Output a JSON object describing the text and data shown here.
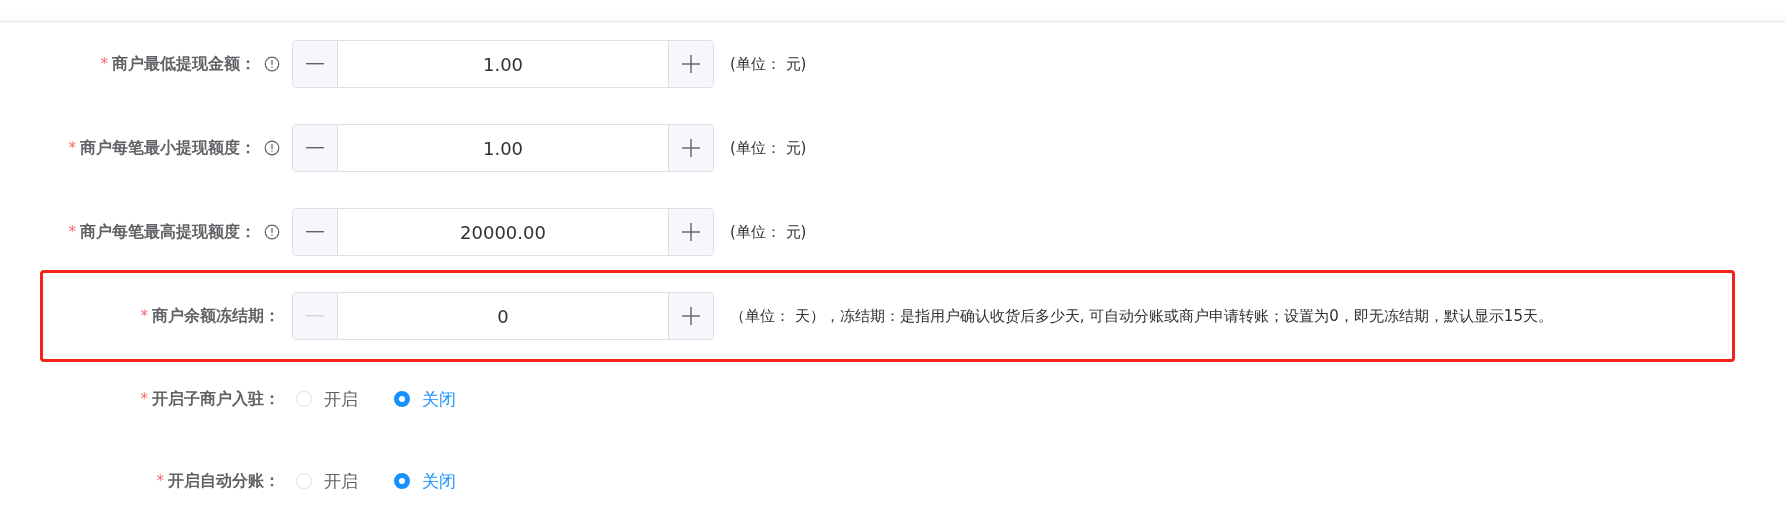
{
  "fields": [
    {
      "kind": "stepper",
      "label": "商户最低提现金额：",
      "required": true,
      "required_mark": "*",
      "info": true,
      "highlighted": false,
      "value": "1.00",
      "minus_disabled": false,
      "hint": "(单位： 元)"
    },
    {
      "kind": "stepper",
      "label": "商户每笔最小提现额度：",
      "required": true,
      "required_mark": "*",
      "info": true,
      "highlighted": false,
      "value": "1.00",
      "minus_disabled": false,
      "hint": "(单位： 元)"
    },
    {
      "kind": "stepper",
      "label": "商户每笔最高提现额度：",
      "required": true,
      "required_mark": "*",
      "info": true,
      "highlighted": false,
      "value": "20000.00",
      "minus_disabled": false,
      "hint": "(单位： 元)"
    },
    {
      "kind": "stepper",
      "label": "商户余额冻结期：",
      "required": true,
      "required_mark": "*",
      "info": false,
      "highlighted": true,
      "value": "0",
      "minus_disabled": true,
      "hint": "（单位： 天），冻结期：是指用户确认收货后多少天, 可自动分账或商户申请转账；设置为0，即无冻结期，默认显示15天。"
    },
    {
      "kind": "radio",
      "label": "开启子商户入驻：",
      "required": true,
      "required_mark": "*",
      "info": false,
      "highlighted": false,
      "options": [
        {
          "label": "开启",
          "selected": false
        },
        {
          "label": "关闭",
          "selected": true
        }
      ]
    },
    {
      "kind": "radio",
      "label": "开启自动分账：",
      "required": true,
      "required_mark": "*",
      "info": false,
      "highlighted": false,
      "options": [
        {
          "label": "开启",
          "selected": false
        },
        {
          "label": "关闭",
          "selected": true
        }
      ]
    }
  ]
}
